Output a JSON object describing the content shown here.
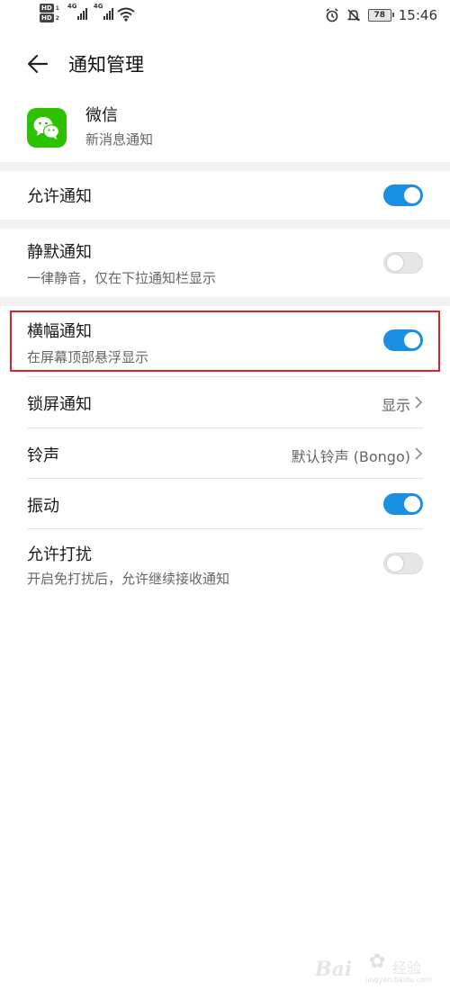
{
  "status_bar": {
    "hd1": "HD",
    "hd1_num": "1",
    "hd2": "HD",
    "hd2_num": "2",
    "net1": "4G",
    "net2": "4G",
    "battery": "78",
    "time": "15:46",
    "icons": [
      "alarm-icon",
      "mute-icon",
      "wifi-icon",
      "signal-icon"
    ]
  },
  "header": {
    "title": "通知管理",
    "back_icon": "arrow-left-icon"
  },
  "app": {
    "name": "微信",
    "subtitle": "新消息通知",
    "icon": "wechat-icon",
    "icon_color": "#2dc100"
  },
  "settings": [
    {
      "title": "允许通知",
      "toggle": true
    },
    {
      "title": "静默通知",
      "subtitle": "一律静音，仅在下拉通知栏显示",
      "toggle": false
    },
    {
      "title": "横幅通知",
      "subtitle": "在屏幕顶部悬浮显示",
      "toggle": true,
      "highlighted": true
    },
    {
      "title": "锁屏通知",
      "value": "显示"
    },
    {
      "title": "铃声",
      "value": "默认铃声 (Bongo)"
    },
    {
      "title": "振动",
      "toggle": true
    },
    {
      "title": "允许打扰",
      "subtitle": "开启免打扰后，允许继续接收通知",
      "toggle": false
    }
  ],
  "colors": {
    "accent": "#1a8fe3",
    "highlight_border": "#e0202a",
    "section_gap": "#f1f1f1"
  },
  "watermark": {
    "text": "Bai",
    "cn": "经验",
    "url": "jingyan.baidu.com"
  }
}
